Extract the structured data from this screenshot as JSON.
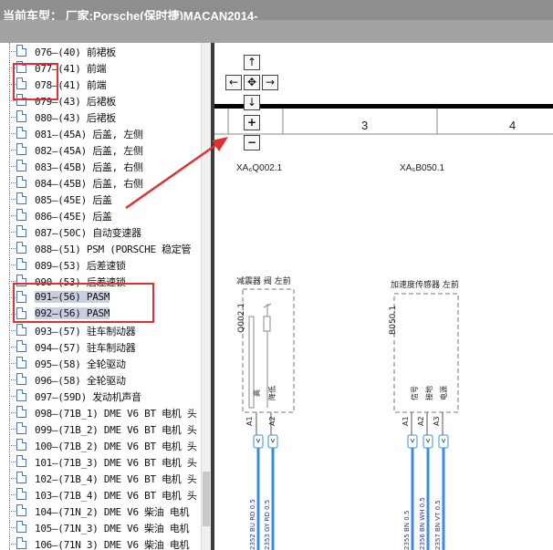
{
  "title": "当前车型： 厂家:Porsche(保时捷)MACAN2014-",
  "colors": {
    "accent_red": "#e03030",
    "wire_blue": "#3a8fd8",
    "selection": "#c8d0e0"
  },
  "tree": {
    "items": [
      {
        "label": "076—(40) 前裙板"
      },
      {
        "label": "077—(41) 前端"
      },
      {
        "label": "078—(41) 前端"
      },
      {
        "label": "079—(43) 后裙板"
      },
      {
        "label": "080—(43) 后裙板"
      },
      {
        "label": "081—(45A) 后盖, 左侧"
      },
      {
        "label": "082—(45A) 后盖, 左侧"
      },
      {
        "label": "083—(45B) 后盖, 右侧"
      },
      {
        "label": "084—(45B) 后盖, 右侧"
      },
      {
        "label": "085—(45E) 后盖"
      },
      {
        "label": "086—(45E) 后盖"
      },
      {
        "label": "087—(50C) 自动变速器"
      },
      {
        "label": "088—(51) PSM (PORSCHE 稳定管"
      },
      {
        "label": "089—(53) 后差速锁"
      },
      {
        "label": "090—(53) 后差速锁"
      },
      {
        "label": "091—(56) PASM",
        "selected": true
      },
      {
        "label": "092—(56) PASM",
        "selected": true
      },
      {
        "label": "093—(57) 驻车制动器"
      },
      {
        "label": "094—(57) 驻车制动器"
      },
      {
        "label": "095—(58) 全轮驱动"
      },
      {
        "label": "096—(58) 全轮驱动"
      },
      {
        "label": "097—(59D) 发动机声音"
      },
      {
        "label": "098—(71B_1) DME V6 BT 电机 头"
      },
      {
        "label": "099—(71B_2) DME V6 BT 电机 头"
      },
      {
        "label": "100—(71B_2) DME V6 BT 电机 头"
      },
      {
        "label": "101—(71B_3) DME V6 BT 电机 头"
      },
      {
        "label": "102—(71B_4) DME V6 BT 电机 头"
      },
      {
        "label": "103—(71B_4) DME V6 BT 电机 头"
      },
      {
        "label": "104—(71N_2) DME V6 柴油 电机"
      },
      {
        "label": "105—(71N_3) DME V6 柴油 电机"
      },
      {
        "label": "106—(71N_3) DME V6 柴油 电机"
      }
    ]
  },
  "nav": {
    "up": "↑",
    "left": "←",
    "center": "✥",
    "right": "→",
    "down": "↓",
    "zoom_in": "+",
    "zoom_out": "−"
  },
  "ruler": {
    "col3": "3",
    "col4": "4"
  },
  "diagram": {
    "conn_left": "XA₆Q002.1",
    "conn_right": "XA₆B050.1",
    "comp_left_title": "减震器 阀 左前",
    "comp_left_id": "Q002.1",
    "comp_left_pin_a": "高",
    "comp_left_pin_b": "降低",
    "comp_right_title": "加速度传感器 左前",
    "comp_right_id": "B050.1",
    "comp_right_pin_a": "信号",
    "comp_right_pin_b": "接地",
    "comp_right_pin_c": "电源",
    "pin_a1": "A1",
    "pin_a2": "A2",
    "pin_a3": "A3",
    "wire_l1": "2352 BU RD 0.5",
    "wire_l2": "2353 GY RD 0.5",
    "wire_r1": "2355 BN 0.5",
    "wire_r2": "2356 BN WH 0.5",
    "wire_r3": "2357 BN VT 0.5"
  }
}
